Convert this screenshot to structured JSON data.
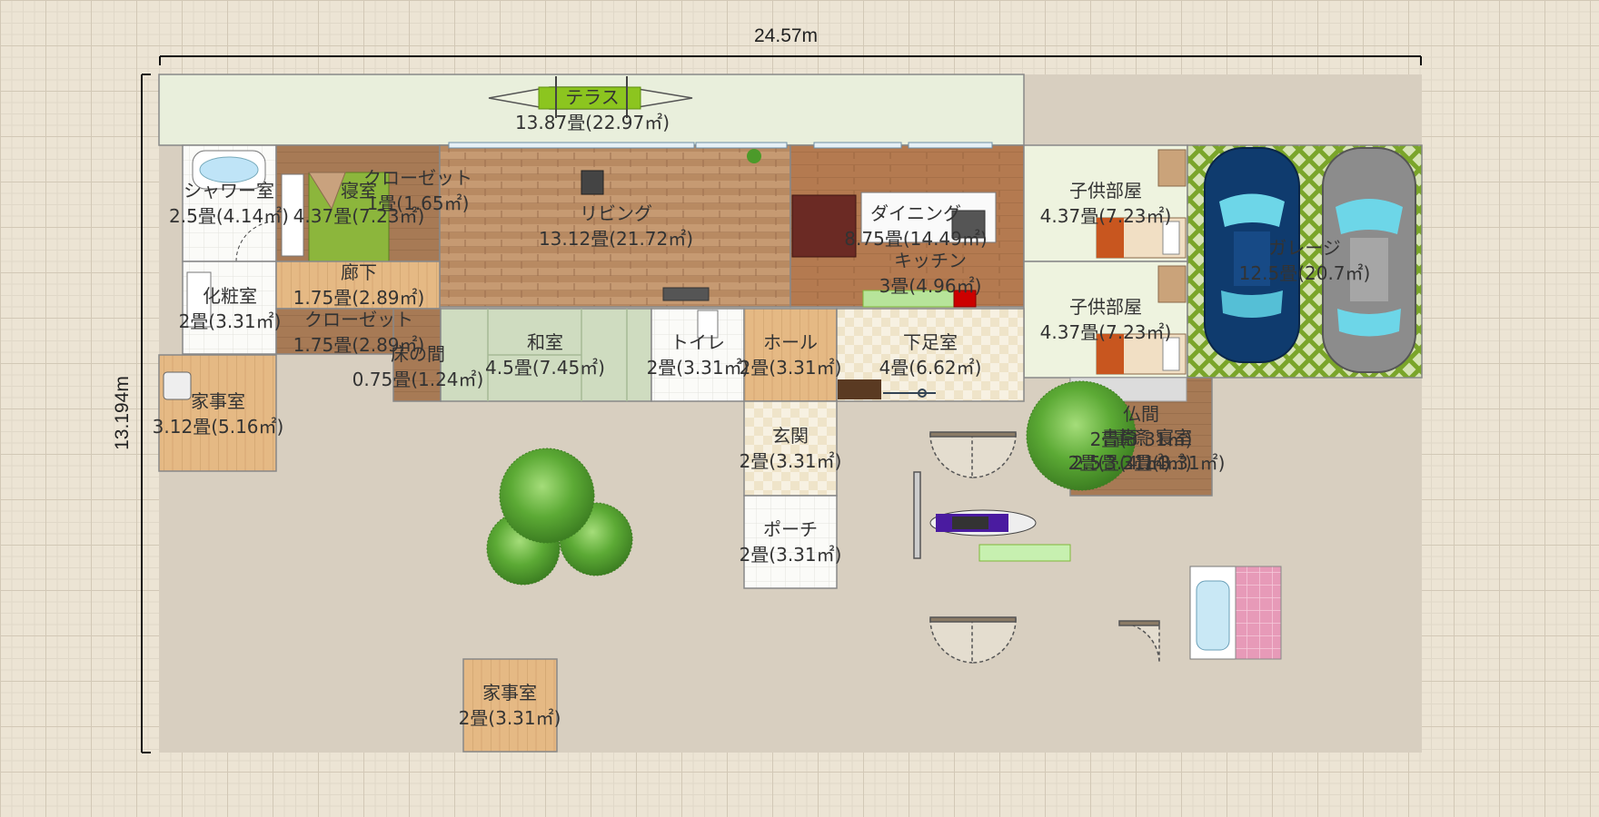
{
  "dimensions": {
    "width_label": "24.57m",
    "height_label": "13.194m"
  },
  "rooms": {
    "terrace": {
      "name": "テラス",
      "area": "13.87畳(22.97㎡)"
    },
    "shower": {
      "name": "シャワー室",
      "area": "2.5畳(4.14㎡)"
    },
    "bedroom": {
      "name": "寝室",
      "area": "4.37畳(7.23㎡)"
    },
    "closet1": {
      "name": "クローゼット",
      "area": "1畳(1.65㎡)"
    },
    "living": {
      "name": "リビング",
      "area": "13.12畳(21.72㎡)"
    },
    "dining": {
      "name": "ダイニング",
      "area": "8.75畳(14.49㎡)"
    },
    "kitchen": {
      "name": "キッチン",
      "area": "3畳(4.96㎡)"
    },
    "kids1": {
      "name": "子供部屋",
      "area": "4.37畳(7.23㎡)"
    },
    "kids2": {
      "name": "子供部屋",
      "area": "4.37畳(7.23㎡)"
    },
    "garage": {
      "name": "ガレージ",
      "area": "12.5畳(20.7㎡)"
    },
    "hallway": {
      "name": "廊下",
      "area": "1.75畳(2.89㎡)"
    },
    "powder": {
      "name": "化粧室",
      "area": "2畳(3.31㎡)"
    },
    "closet2": {
      "name": "クローゼット",
      "area": "1.75畳(2.89㎡)"
    },
    "tokonoma": {
      "name": "床の間",
      "area": "0.75畳(1.24㎡)"
    },
    "washitsu": {
      "name": "和室",
      "area": "4.5畳(7.45㎡)"
    },
    "toilet": {
      "name": "トイレ",
      "area": "2畳(3.31㎡)"
    },
    "hall": {
      "name": "ホール",
      "area": "2畳(3.31㎡)"
    },
    "shoeroom": {
      "name": "下足室",
      "area": "4畳(6.62㎡)"
    },
    "utility1": {
      "name": "家事室",
      "area": "3.12畳(5.16㎡)"
    },
    "entrance": {
      "name": "玄関",
      "area": "2畳(3.31㎡)"
    },
    "porch": {
      "name": "ポーチ",
      "area": "2畳(3.31㎡)"
    },
    "butsuma": {
      "name": "仏間",
      "area": "2畳(3.31㎡)"
    },
    "study": {
      "name": "書斎",
      "area": "2畳(3.31㎡)"
    },
    "study2": {
      "name": "書斎",
      "area": "2.5畳(4.14㎡)"
    },
    "bedroom2": {
      "name": "寝室",
      "area": "2畳(3.31㎡)"
    },
    "utility2": {
      "name": "家事室",
      "area": "2畳(3.31㎡)"
    }
  },
  "colors": {
    "terrace": "#e9efdc",
    "wood_light": "#deb887",
    "wood_dark": "#a7744b",
    "tatami": "#cfdcc0",
    "tile": "#f4ecd8",
    "green_mat": "#7fb83a"
  }
}
